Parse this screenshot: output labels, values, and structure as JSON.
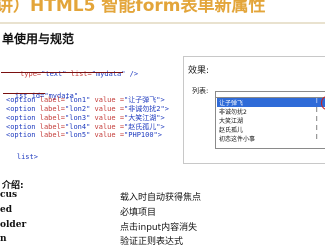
{
  "banner": {
    "title": "讲）HTML5 智能form表单新属性"
  },
  "heading": "单使用与规范",
  "code": {
    "input_line": {
      "prefix": " type=",
      "type_val": "\"text\"",
      "mid": " list=",
      "list_val": "\"mydata\"",
      "suffix": " />"
    },
    "datalist_open": {
      "prefix": "ist id=",
      "id_val": "\"mydata\""
    },
    "options": [
      {
        "label_val": "\"lon1\"",
        "value_val": "\"让子弹飞\""
      },
      {
        "label_val": "\"lon2\"",
        "value_val": "\"非诚勿扰2\""
      },
      {
        "label_val": "\"lon3\"",
        "value_val": "\"大笑江湖\""
      },
      {
        "label_val": "\"lon4\"",
        "value_val": "\"赵氏孤儿\""
      },
      {
        "label_val": "\"lon5\"",
        "value_val": "\"PHP100\""
      }
    ],
    "option_tag": "<option",
    "label_attr": " label=",
    "value_attr": " value =",
    "close": ">",
    "datalist_close": "list>"
  },
  "preview": {
    "result_label": "效果:",
    "list_label": "列表:",
    "items": [
      {
        "text": "让子弹飞",
        "tail": "l"
      },
      {
        "text": "非诚勿扰2",
        "tail": "l"
      },
      {
        "text": "大笑江湖",
        "tail": "l"
      },
      {
        "text": "赵氏孤儿",
        "tail": "l"
      },
      {
        "text": "初恋这件小事",
        "tail": "l"
      }
    ]
  },
  "attrs_section": {
    "title": "介绍:",
    "rows": [
      {
        "name": "cus",
        "desc": "载入时自动获得焦点"
      },
      {
        "name": "ed",
        "desc": "必填项目"
      },
      {
        "name": "older",
        "desc": "点击input内容消失"
      },
      {
        "name": "n",
        "desc": "验证正则表达式"
      }
    ]
  },
  "colors": {
    "banner": "#e3a53a",
    "tag": "#1f3bbf",
    "attr": "#c43c39",
    "selected": "#2f6bd8"
  }
}
